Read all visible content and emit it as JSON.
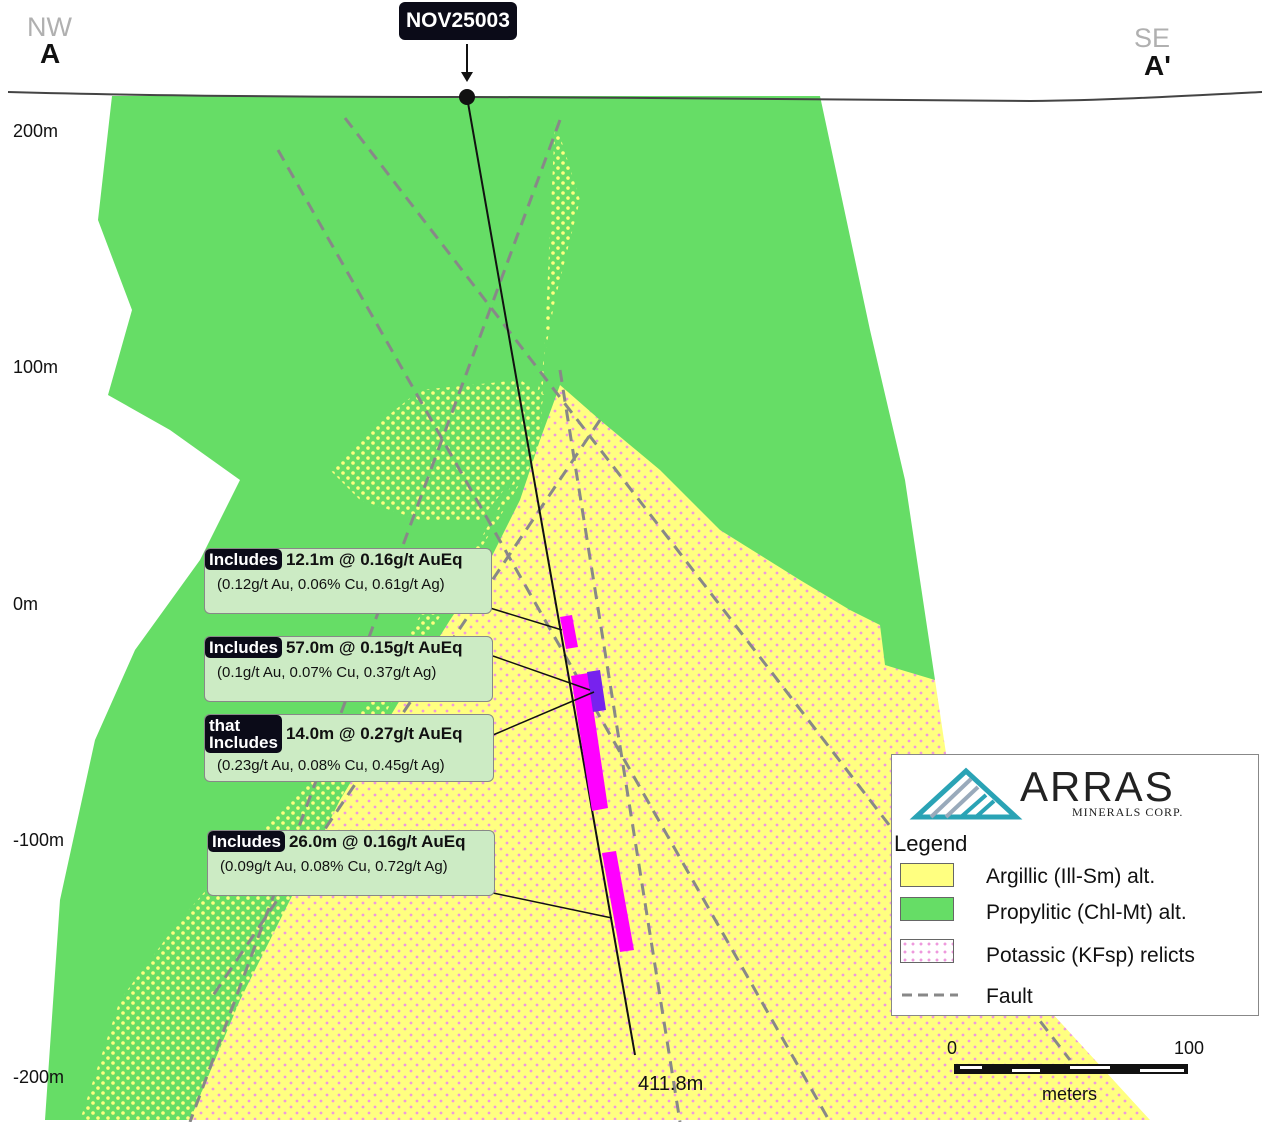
{
  "section": {
    "nw_direction": "NW",
    "nw_label": "A",
    "se_direction": "SE",
    "se_label": "A'",
    "drillhole_id": "NOV25003",
    "end_of_hole": "411.8m",
    "elevation_labels": [
      "200m",
      "100m",
      "0m",
      "-100m",
      "-200m"
    ]
  },
  "intercepts": [
    {
      "tag": "Includes",
      "headline": "12.1m @ 0.16g/t AuEq",
      "detail": "(0.12g/t Au, 0.06% Cu, 0.61g/t Ag)"
    },
    {
      "tag": "Includes",
      "headline": "57.0m @ 0.15g/t AuEq",
      "detail": "(0.1g/t Au, 0.07% Cu, 0.37g/t Ag)"
    },
    {
      "tag": "that Includes",
      "tag_line1": "that",
      "tag_line2": "Includes",
      "headline": "14.0m @ 0.27g/t AuEq",
      "detail": "(0.23g/t Au, 0.08% Cu, 0.45g/t Ag)"
    },
    {
      "tag": "Includes",
      "headline": "26.0m @ 0.16g/t AuEq",
      "detail": "(0.09g/t Au, 0.08% Cu, 0.72g/t Ag)"
    }
  ],
  "logo": {
    "name": "ARRAS",
    "subtitle": "MINERALS CORP."
  },
  "legend": {
    "title": "Legend",
    "items": [
      {
        "label": "Argillic (Ill-Sm) alt.",
        "color": "#ffff80"
      },
      {
        "label": "Propylitic (Chl-Mt) alt.",
        "color": "#66dd66"
      },
      {
        "label": "Potassic (KFsp) relicts",
        "color": "#ffccee"
      },
      {
        "label": "Fault",
        "color": "#888888"
      }
    ]
  },
  "scale_bar": {
    "start": "0",
    "end": "100",
    "unit": "meters"
  },
  "colors": {
    "propylitic": "#66dd66",
    "argillic": "#ffff80",
    "potassic_dots": "#ee99dd",
    "intercept": "#ff00ff",
    "high_grade": "#7722ee",
    "fault": "#888888"
  }
}
